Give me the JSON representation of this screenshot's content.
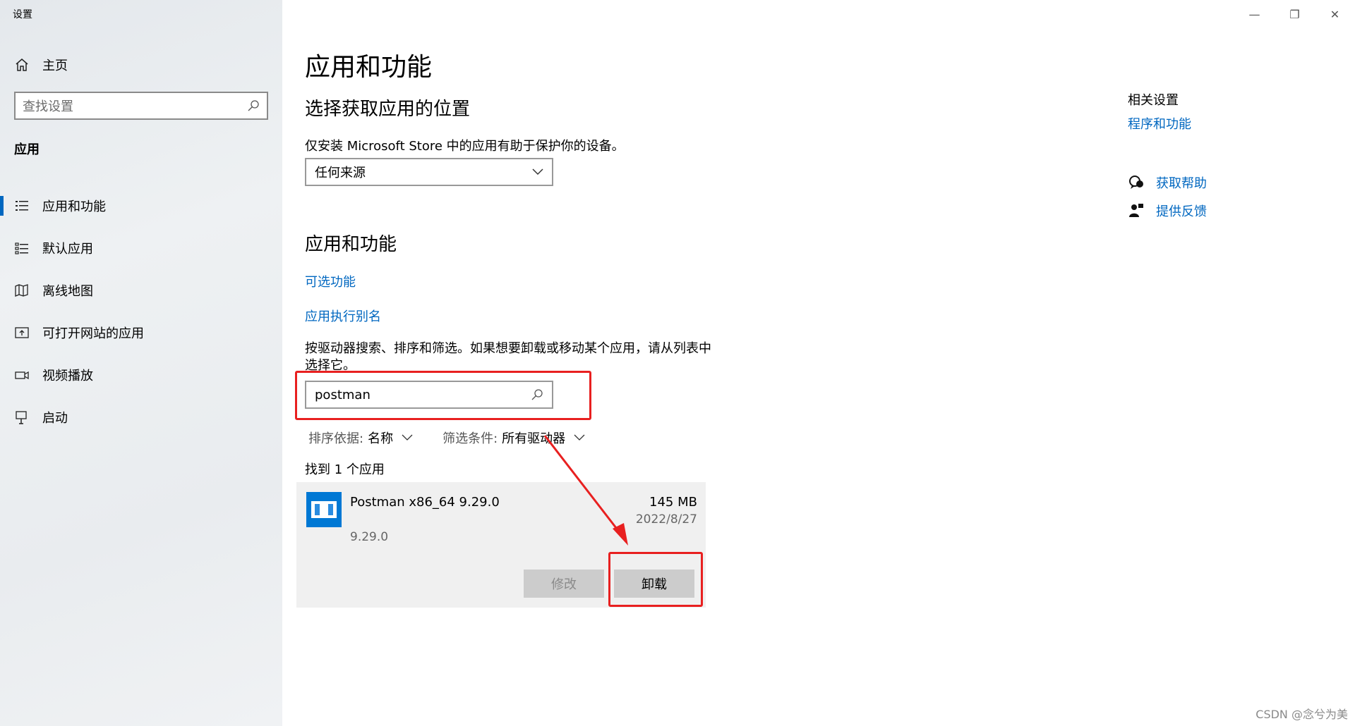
{
  "window": {
    "title": "设置",
    "controls": {
      "minimize": "—",
      "restore": "❐",
      "close": "✕"
    }
  },
  "sidebar": {
    "home_label": "主页",
    "search_placeholder": "查找设置",
    "section_title": "应用",
    "items": [
      {
        "label": "应用和功能",
        "icon": "list-icon",
        "active": true
      },
      {
        "label": "默认应用",
        "icon": "default-apps-icon",
        "active": false
      },
      {
        "label": "离线地图",
        "icon": "map-icon",
        "active": false
      },
      {
        "label": "可打开网站的应用",
        "icon": "open-website-icon",
        "active": false
      },
      {
        "label": "视频播放",
        "icon": "video-icon",
        "active": false
      },
      {
        "label": "启动",
        "icon": "startup-icon",
        "active": false
      }
    ]
  },
  "main": {
    "page_title": "应用和功能",
    "location_heading": "选择获取应用的位置",
    "location_description": "仅安装 Microsoft Store 中的应用有助于保护你的设备。",
    "source_dropdown_value": "任何来源",
    "apps_heading": "应用和功能",
    "link_optional_features": "可选功能",
    "link_app_aliases": "应用执行别名",
    "search_description": "按驱动器搜索、排序和筛选。如果想要卸载或移动某个应用，请从列表中选择它。",
    "search_value": "postman",
    "sort_label": "排序依据:",
    "sort_value": "名称",
    "filter_label": "筛选条件:",
    "filter_value": "所有驱动器",
    "found_count": "找到 1 个应用",
    "app": {
      "name": "Postman x86_64 9.29.0",
      "version": "9.29.0",
      "size": "145 MB",
      "date": "2022/8/27",
      "modify_label": "修改",
      "uninstall_label": "卸载"
    }
  },
  "related": {
    "title": "相关设置",
    "programs_link": "程序和功能",
    "help_label": "获取帮助",
    "feedback_label": "提供反馈"
  },
  "watermark": "CSDN @念兮为美",
  "colors": {
    "accent": "#0067c0",
    "annotation": "#e82020",
    "app_icon": "#0078d4"
  }
}
